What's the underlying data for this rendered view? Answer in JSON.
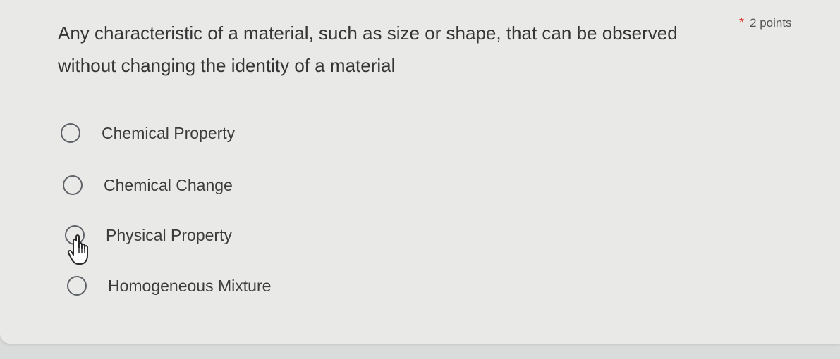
{
  "question": {
    "text": "Any characteristic of a material, such as size or shape, that can be observed without changing the identity of a material",
    "required_marker": "*",
    "points_label": "2 points"
  },
  "options": [
    {
      "label": "Chemical Property"
    },
    {
      "label": "Chemical Change"
    },
    {
      "label": "Physical Property"
    },
    {
      "label": "Homogeneous Mixture"
    }
  ],
  "cursor": {
    "icon": "hand-pointer-icon"
  }
}
